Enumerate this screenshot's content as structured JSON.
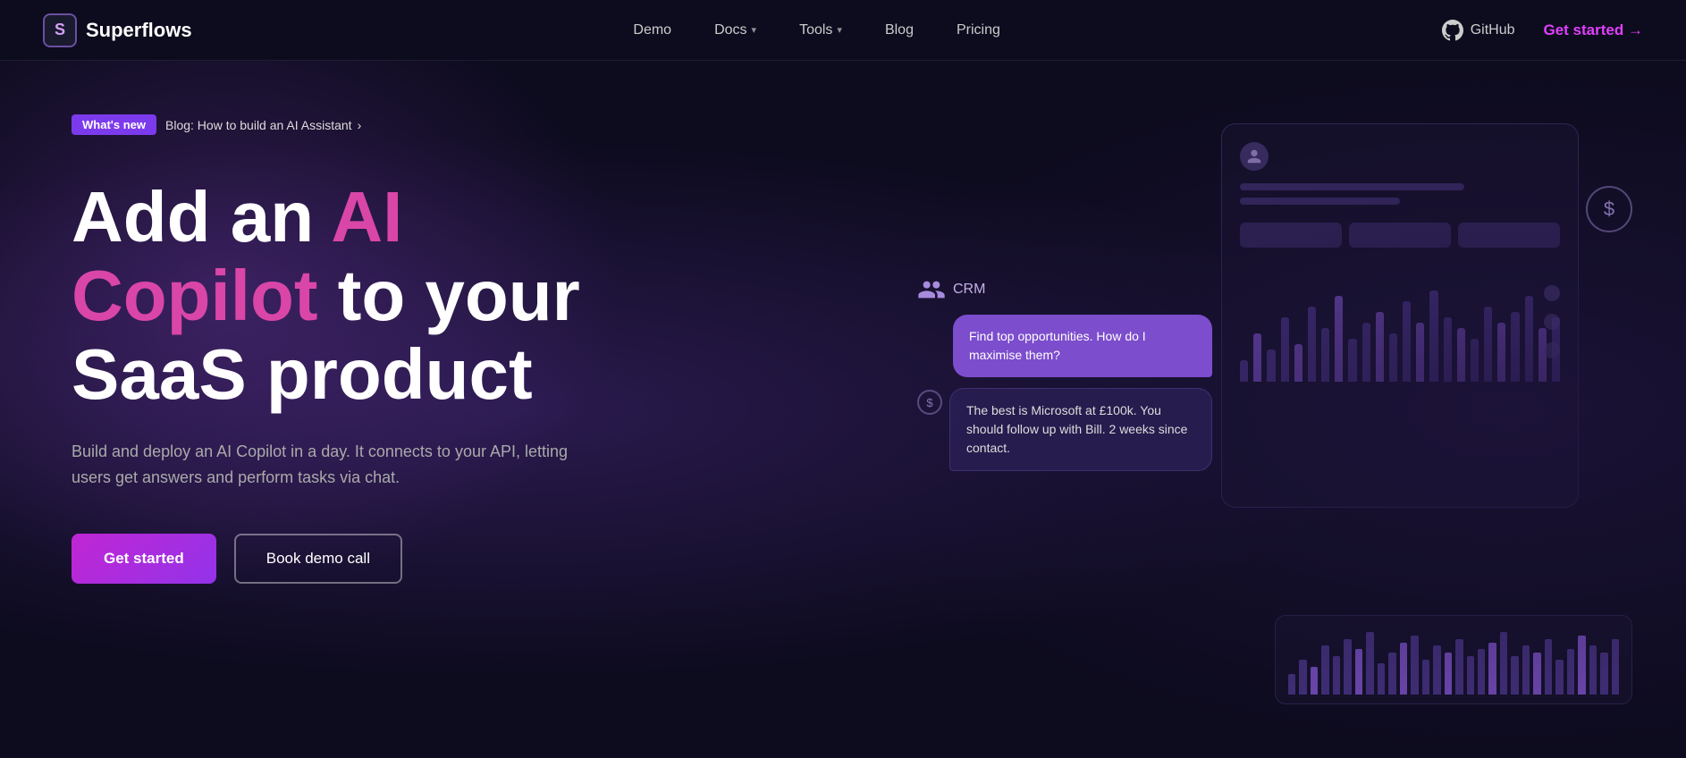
{
  "nav": {
    "logo_letter": "S",
    "logo_name": "Superflows",
    "links": [
      {
        "label": "Demo",
        "has_dropdown": false
      },
      {
        "label": "Docs",
        "has_dropdown": true
      },
      {
        "label": "Tools",
        "has_dropdown": true
      },
      {
        "label": "Blog",
        "has_dropdown": false
      },
      {
        "label": "Pricing",
        "has_dropdown": false
      }
    ],
    "github_label": "GitHub",
    "get_started_label": "Get started →"
  },
  "hero": {
    "badge_new": "What's new",
    "badge_blog": "Blog: How to build an AI Assistant",
    "title_part1": "Add an ",
    "title_highlight": "AI Copilot",
    "title_part2": " to your SaaS product",
    "subtitle": "Build and deploy an AI Copilot in a day. It connects to your API, letting users get answers and perform tasks via chat.",
    "btn_primary": "Get started",
    "btn_secondary": "Book demo call",
    "crm_label": "CRM",
    "bubble_user": "Find top opportunities. How do I maximise them?",
    "bubble_reply": "The best is Microsoft at £100k. You should follow up with Bill. 2 weeks since contact."
  },
  "bars": [
    20,
    45,
    30,
    60,
    35,
    70,
    50,
    80,
    40,
    55,
    65,
    45,
    75,
    55,
    85,
    60,
    50,
    40,
    70,
    55,
    65,
    80,
    50,
    60
  ],
  "mini_bars": [
    30,
    50,
    40,
    70,
    55,
    80,
    65,
    90,
    45,
    60,
    75,
    85,
    50,
    70,
    60,
    80,
    55,
    65,
    75,
    90,
    55,
    70,
    60,
    80,
    50,
    65,
    85,
    70,
    60,
    80
  ]
}
